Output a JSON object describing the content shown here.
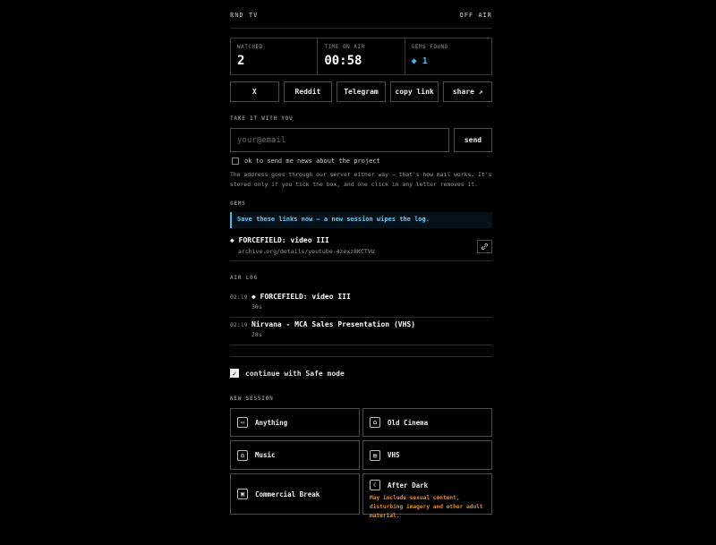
{
  "header": {
    "brand": "RND TV",
    "status": "OFF AIR"
  },
  "stats": [
    {
      "label": "WATCHED",
      "value": "2"
    },
    {
      "label": "TIME ON AIR",
      "value": "00:58"
    },
    {
      "label": "GEMS FOUND",
      "value": "◆ 1"
    }
  ],
  "share": {
    "buttons": [
      "X",
      "Reddit",
      "Telegram",
      "copy link",
      "share ↗"
    ]
  },
  "email": {
    "section_label": "TAKE IT WITH YOU",
    "placeholder": "your@email",
    "send_label": "send",
    "optin_label": "ok to send me news about the project",
    "note": "The address goes through our server either way — that's how mail works. It's stored only if you tick the box, and one click in any letter removes it."
  },
  "gems": {
    "section_label": "GEMS",
    "warning": "Save these links now — a new session wipes the log.",
    "items": [
      {
        "title": "◆ FORCEFIELD: video III",
        "url": "archive.org/details/youtube-4zexz8KCTVU"
      }
    ]
  },
  "air_log": {
    "section_label": "AIR LOG",
    "items": [
      {
        "time": "02:19",
        "title": "◆ FORCEFIELD: video III",
        "duration": "30s"
      },
      {
        "time": "02:19",
        "title": "Nirvana - MCA Sales Presentation (VHS)",
        "duration": "28s"
      }
    ]
  },
  "safe_mode": {
    "label": "continue with Safe mode",
    "checked": true
  },
  "new_session": {
    "section_label": "NEW SESSION",
    "tiles": [
      {
        "name": "Anything",
        "icon": "tv-icon"
      },
      {
        "name": "Old Cinema",
        "icon": "projector-icon"
      },
      {
        "name": "Music",
        "icon": "speaker-icon"
      },
      {
        "name": "VHS",
        "icon": "film-icon"
      },
      {
        "name": "Commercial Break",
        "icon": "radio-icon"
      },
      {
        "name": "After Dark",
        "icon": "moon-icon",
        "warning": "May include sexual content, disturbing imagery and other adult material."
      }
    ]
  },
  "colors": {
    "accent": "#4fb6e8",
    "warning": "#f08a1e",
    "background": "#000000"
  }
}
